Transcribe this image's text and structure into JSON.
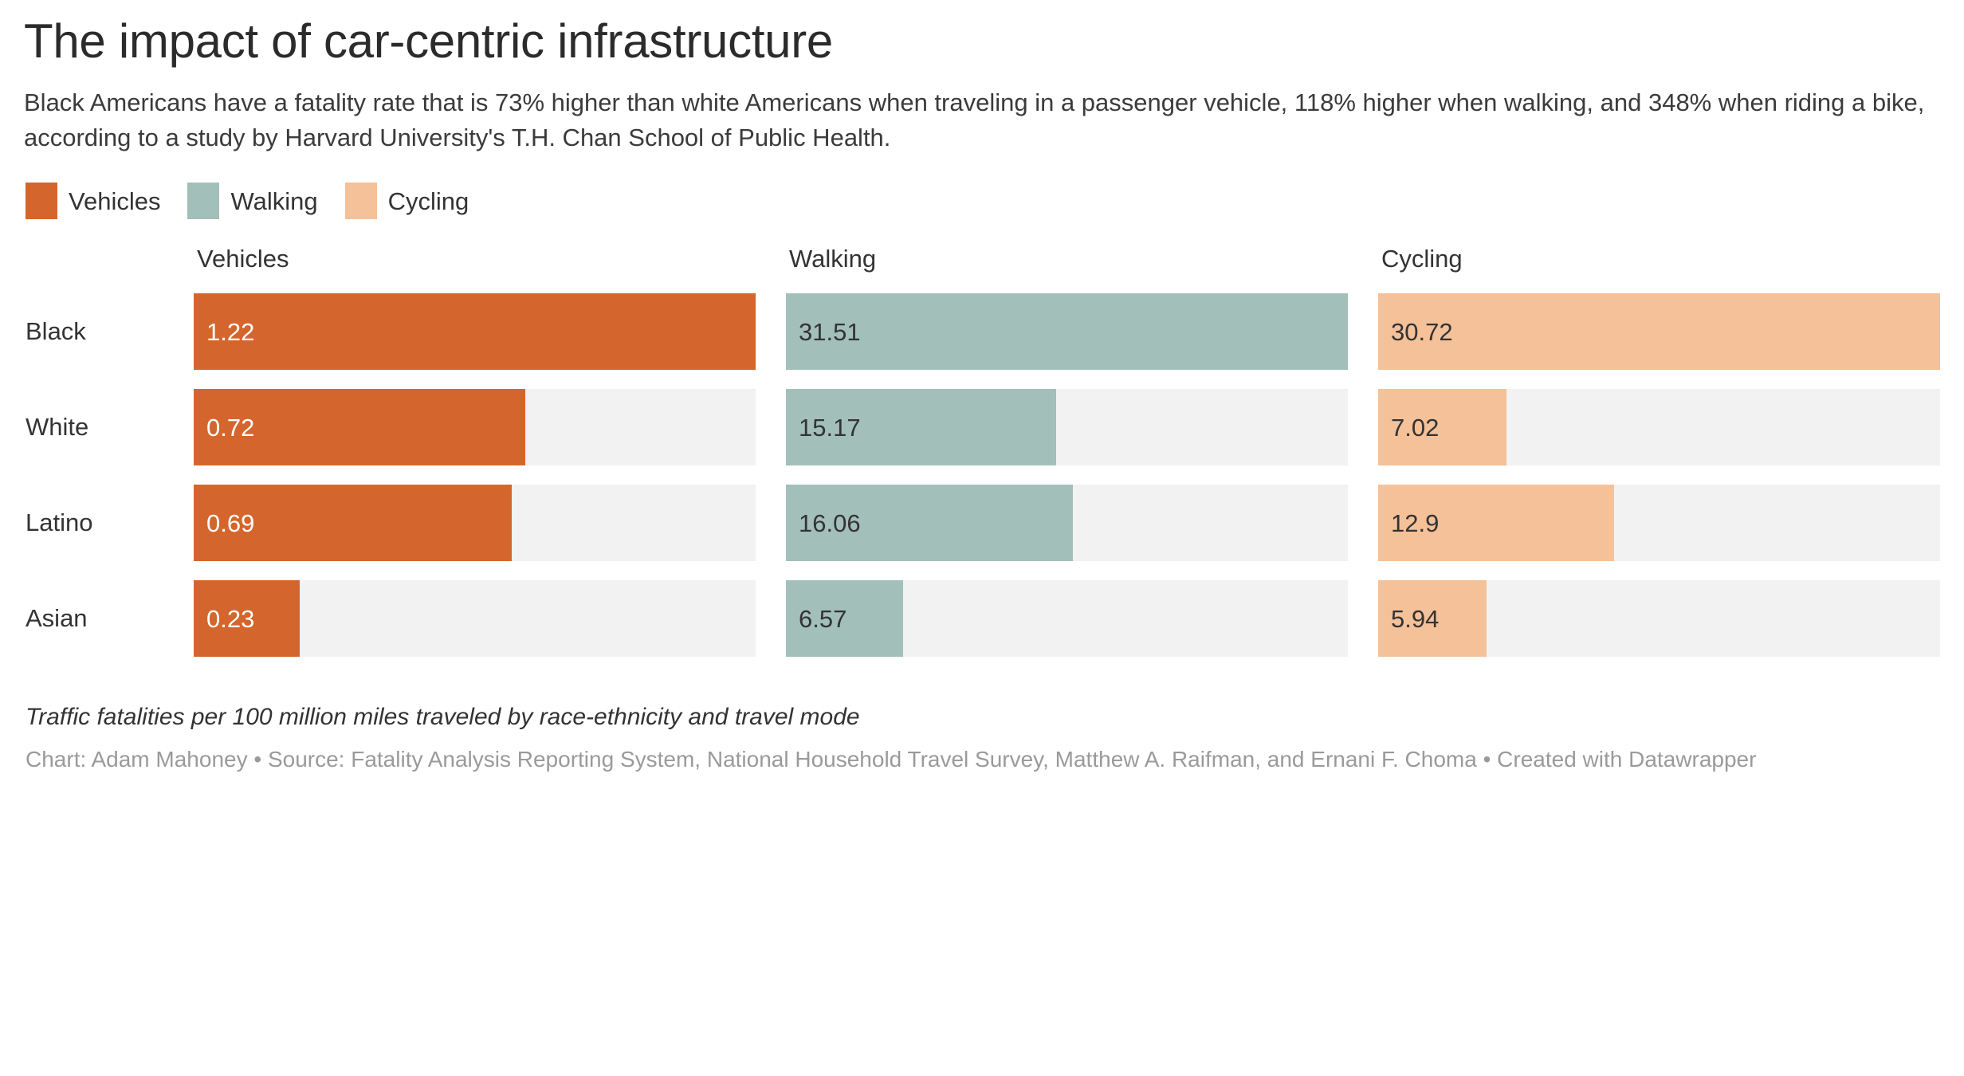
{
  "header": {
    "title": "The impact of car-centric infrastructure",
    "subtitle": "Black Americans have a fatality rate that is 73% higher than white Americans when traveling in a passenger vehicle, 118% higher when walking, and 348% when riding a bike, according to a study by Harvard University's T.H. Chan School of Public Health."
  },
  "legend": {
    "items": [
      {
        "label": "Vehicles",
        "color": "#d4662d"
      },
      {
        "label": "Walking",
        "color": "#a3bfb9"
      },
      {
        "label": "Cycling",
        "color": "#f5c199"
      }
    ]
  },
  "panels": {
    "headers": [
      "Vehicles",
      "Walking",
      "Cycling"
    ]
  },
  "rows": {
    "labels": [
      "Black",
      "White",
      "Latino",
      "Asian"
    ]
  },
  "cells": {
    "vehicles": [
      {
        "label": "1.22",
        "value": 1.22,
        "pct": 100.0,
        "text": "light"
      },
      {
        "label": "0.72",
        "value": 0.72,
        "pct": 59.0,
        "text": "light"
      },
      {
        "label": "0.69",
        "value": 0.69,
        "pct": 56.6,
        "text": "light"
      },
      {
        "label": "0.23",
        "value": 0.23,
        "pct": 18.9,
        "text": "light"
      }
    ],
    "walking": [
      {
        "label": "31.51",
        "value": 31.51,
        "pct": 100.0,
        "text": "dark"
      },
      {
        "label": "15.17",
        "value": 15.17,
        "pct": 48.1,
        "text": "dark"
      },
      {
        "label": "16.06",
        "value": 16.06,
        "pct": 51.0,
        "text": "dark"
      },
      {
        "label": "6.57",
        "value": 6.57,
        "pct": 20.8,
        "text": "dark"
      }
    ],
    "cycling": [
      {
        "label": "30.72",
        "value": 30.72,
        "pct": 100.0,
        "text": "dark"
      },
      {
        "label": "7.02",
        "value": 7.02,
        "pct": 22.9,
        "text": "dark"
      },
      {
        "label": "12.9",
        "value": 12.9,
        "pct": 42.0,
        "text": "dark"
      },
      {
        "label": "5.94",
        "value": 5.94,
        "pct": 19.3,
        "text": "dark"
      }
    ]
  },
  "footer": {
    "note": "Traffic fatalities per 100 million miles traveled by race-ethnicity and travel mode",
    "credit": "Chart: Adam Mahoney • Source: Fatality Analysis Reporting System, National Household Travel Survey, Matthew A. Raifman, and Ernani F. Choma • Created with Datawrapper"
  },
  "colors": {
    "vehicles": "#d4662d",
    "walking": "#a3bfb9",
    "cycling": "#f5c199",
    "track": "#f2f2f2",
    "text": "#333333",
    "muted": "#9a9a9a"
  },
  "chart_data": {
    "type": "bar",
    "title": "The impact of car-centric infrastructure",
    "subtitle": "Black Americans have a fatality rate that is 73% higher than white Americans when traveling in a passenger vehicle, 118% higher when walking, and 348% when riding a bike, according to a study by Harvard University's T.H. Chan School of Public Health.",
    "xlabel": "Traffic fatalities per 100 million miles traveled",
    "ylabel": "Race-ethnicity",
    "categories": [
      "Black",
      "White",
      "Latino",
      "Asian"
    ],
    "series": [
      {
        "name": "Vehicles",
        "color": "#d4662d",
        "values": [
          1.22,
          0.72,
          0.69,
          0.23
        ],
        "panel_max": 1.22
      },
      {
        "name": "Walking",
        "color": "#a3bfb9",
        "values": [
          31.51,
          15.17,
          16.06,
          6.57
        ],
        "panel_max": 31.51
      },
      {
        "name": "Cycling",
        "color": "#f5c199",
        "values": [
          30.72,
          7.02,
          12.9,
          5.94
        ],
        "panel_max": 30.72
      }
    ],
    "layout": "small-multiples-horizontal-bars",
    "grid": false,
    "legend_position": "top-left",
    "data_labels": true,
    "note": "Traffic fatalities per 100 million miles traveled by race-ethnicity and travel mode",
    "source": "Chart: Adam Mahoney • Source: Fatality Analysis Reporting System, National Household Travel Survey, Matthew A. Raifman, and Ernani F. Choma • Created with Datawrapper"
  }
}
